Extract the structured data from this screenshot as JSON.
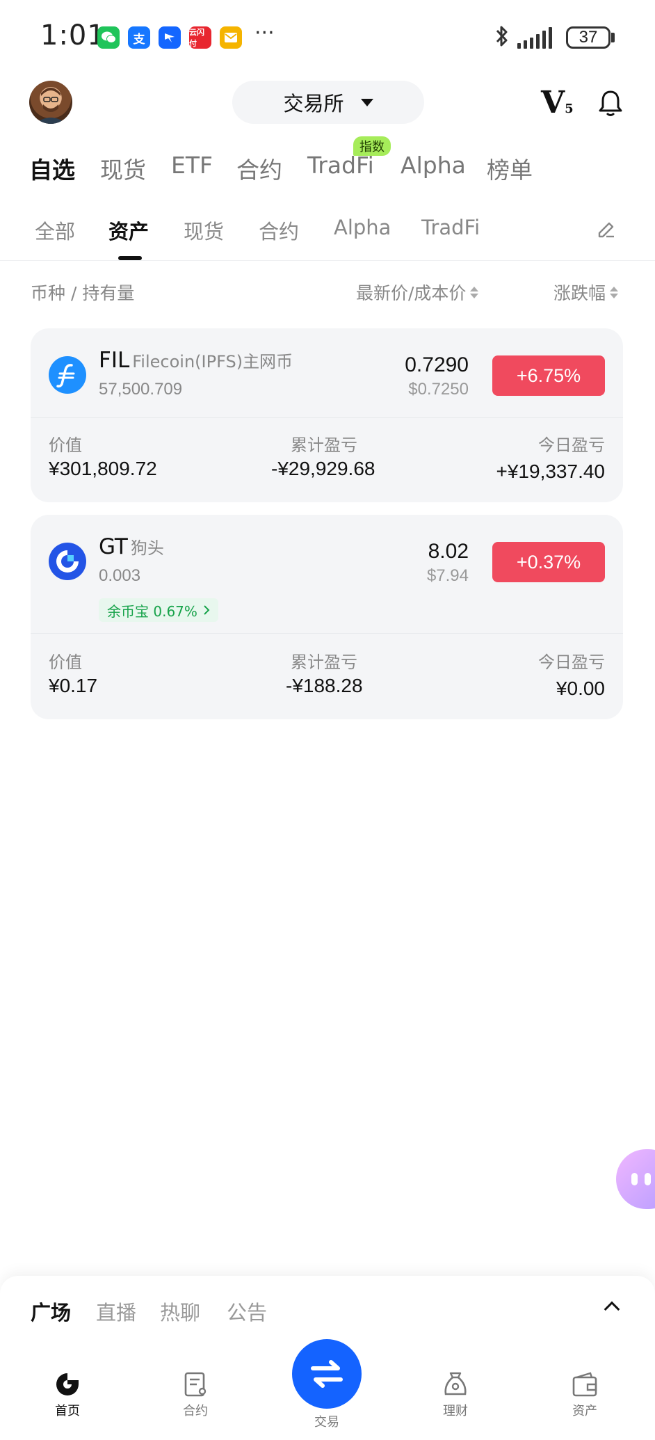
{
  "status_bar": {
    "time": "1:01",
    "battery": "37",
    "apps": [
      {
        "name": "wechat-icon",
        "color": "#1fc45a",
        "glyph": "✉"
      },
      {
        "name": "alipay-icon",
        "color": "#1677ff",
        "glyph": "支"
      },
      {
        "name": "dingtalk-icon",
        "color": "#1466ff",
        "glyph": "➤"
      },
      {
        "name": "yunshanfu-icon",
        "color": "#e8262f",
        "glyph": "云"
      },
      {
        "name": "mail-icon",
        "color": "#f5b400",
        "glyph": "✉"
      }
    ],
    "more": "···"
  },
  "header": {
    "exchange_label": "交易所",
    "vip_letter": "V",
    "vip_level": "5"
  },
  "main_tabs": [
    "自选",
    "现货",
    "ETF",
    "合约",
    "TradFi",
    "Alpha",
    "榜单"
  ],
  "main_tab_tag": "指数",
  "sub_tabs": [
    "全部",
    "资产",
    "现货",
    "合约",
    "Alpha",
    "TradFi"
  ],
  "columns": {
    "coin": "币种 / 持有量",
    "price": "最新价/成本价",
    "change": "涨跌幅"
  },
  "assets": [
    {
      "symbol": "FIL",
      "name": "Filecoin(IPFS)主网币",
      "holding": "57,500.709",
      "price": "0.7290",
      "cost": "$0.7250",
      "change": "+6.75%",
      "value_label": "价值",
      "value": "¥301,809.72",
      "pnl_label": "累计盈亏",
      "pnl": "-¥29,929.68",
      "today_label": "今日盈亏",
      "today": "+¥19,337.40"
    },
    {
      "symbol": "GT",
      "name": "狗头",
      "holding": "0.003",
      "price": "8.02",
      "cost": "$7.94",
      "change": "+0.37%",
      "earn_tag": "余币宝 0.67%",
      "value_label": "价值",
      "value": "¥0.17",
      "pnl_label": "累计盈亏",
      "pnl": "-¥188.28",
      "today_label": "今日盈亏",
      "today": "¥0.00"
    }
  ],
  "community_tabs": [
    "广场",
    "直播",
    "热聊",
    "公告"
  ],
  "bottom_nav": {
    "home": "首页",
    "futures": "合约",
    "trade": "交易",
    "earn": "理财",
    "assets": "资产"
  },
  "colors": {
    "up": "#f04a5e",
    "accent": "#1463ff",
    "earn_green": "#17a34a",
    "tag_green": "#a6ec5a"
  }
}
